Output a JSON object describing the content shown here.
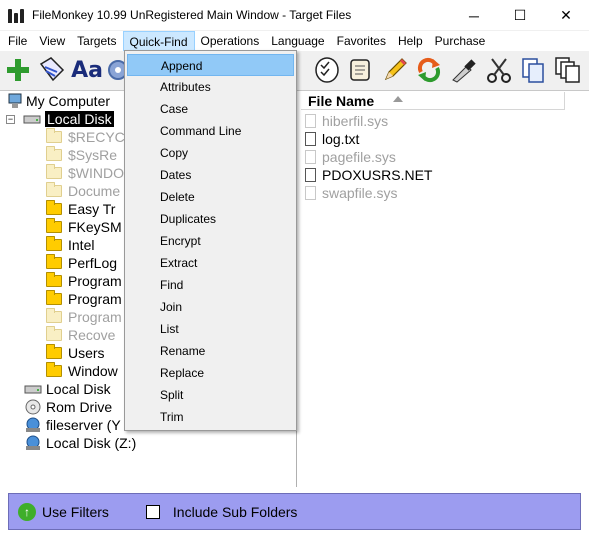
{
  "window": {
    "title": "FileMonkey 10.99 UnRegistered Main Window - Target Files",
    "minimize": "─",
    "maximize": "☐",
    "close": "✕"
  },
  "menu": {
    "items": [
      "File",
      "View",
      "Targets",
      "Quick-Find",
      "Operations",
      "Language",
      "Favorites",
      "Help",
      "Purchase"
    ],
    "active": "Quick-Find"
  },
  "toolbar": {
    "icons": [
      "add-icon",
      "tag-icon",
      "font-case-icon",
      "gear-icon",
      "checklist-icon",
      "scroll-icon",
      "pencil-icon",
      "refresh-icon",
      "knife-icon",
      "scissors-icon",
      "copy-icon",
      "duplicate-pages-icon"
    ],
    "font_case_label": "Aa"
  },
  "tree": {
    "root": "My Computer",
    "drive_c": "Local Disk",
    "folders": [
      {
        "label": "$RECYC",
        "dim": true
      },
      {
        "label": "$SysRe",
        "dim": true
      },
      {
        "label": "$WINDO",
        "dim": true
      },
      {
        "label": "Docume",
        "dim": true
      },
      {
        "label": "Easy Tr",
        "dim": false
      },
      {
        "label": "FKeySM",
        "dim": false
      },
      {
        "label": "Intel",
        "dim": false
      },
      {
        "label": "PerfLog",
        "dim": false
      },
      {
        "label": "Program",
        "dim": false
      },
      {
        "label": "Program",
        "dim": false
      },
      {
        "label": "Program",
        "dim": true
      },
      {
        "label": "Recove",
        "dim": true
      },
      {
        "label": "Users",
        "dim": false
      },
      {
        "label": "Window",
        "dim": false
      }
    ],
    "drives": [
      {
        "label": "Local Disk",
        "icon": "hard-drive-icon"
      },
      {
        "label": "Rom Drive",
        "icon": "cd-drive-icon"
      },
      {
        "label": "fileserver (Y",
        "icon": "network-drive-icon"
      },
      {
        "label": "Local Disk (Z:)",
        "icon": "network-drive-icon"
      }
    ]
  },
  "files": {
    "column_header": "File Name",
    "rows": [
      {
        "name": "hiberfil.sys",
        "dim": true
      },
      {
        "name": "log.txt",
        "dim": false
      },
      {
        "name": "pagefile.sys",
        "dim": true
      },
      {
        "name": "PDOXUSRS.NET",
        "dim": false
      },
      {
        "name": "swapfile.sys",
        "dim": true
      }
    ]
  },
  "bottom": {
    "use_filters": "Use Filters",
    "include_sub_folders": "Include Sub Folders",
    "include_sub_folders_checked": false
  },
  "quickfind_menu": {
    "items": [
      "Append",
      "Attributes",
      "Case",
      "Command Line",
      "Copy",
      "Dates",
      "Delete",
      "Duplicates",
      "Encrypt",
      "Extract",
      "Find",
      "Join",
      "List",
      "Rename",
      "Replace",
      "Split",
      "Trim"
    ],
    "highlighted": "Append"
  }
}
